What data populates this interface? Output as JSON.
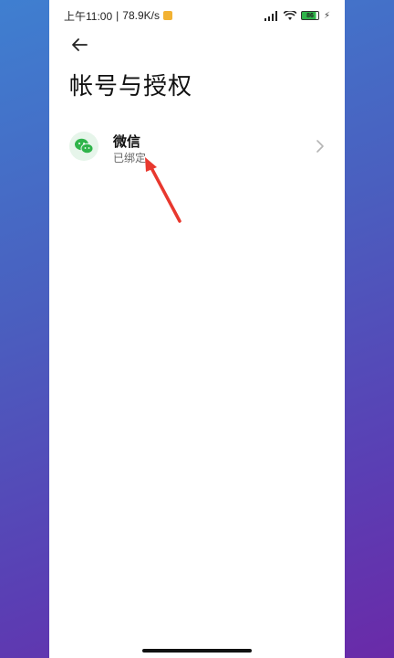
{
  "status_bar": {
    "time": "上午11:00",
    "separator": "|",
    "network_speed": "78.9K/s",
    "battery_level": "86",
    "icons": [
      "notification-icon",
      "signal-icon",
      "wifi-icon",
      "battery-icon",
      "charging-icon"
    ]
  },
  "header": {
    "back_icon": "back-arrow-icon",
    "title": "帐号与授权"
  },
  "accounts": [
    {
      "name": "微信",
      "status": "已绑定",
      "icon": "wechat-icon"
    }
  ],
  "colors": {
    "wechat_green": "#2fb44a",
    "annotation_red": "#e8382e"
  }
}
